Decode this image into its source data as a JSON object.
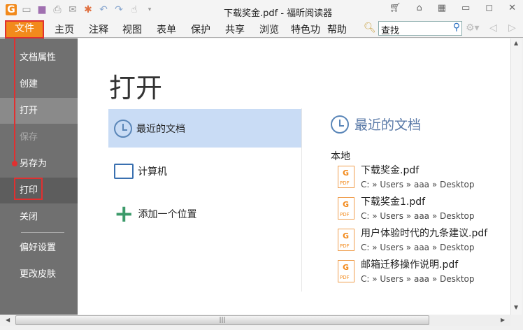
{
  "window": {
    "title": "下载奖金.pdf - 福昕阅读器"
  },
  "menu": {
    "file": "文件",
    "items": [
      "主页",
      "注释",
      "视图",
      "表单",
      "保护",
      "共享",
      "浏览",
      "特色功",
      "帮助"
    ],
    "search_placeholder": "查找"
  },
  "sidebar": {
    "items": [
      "文档属性",
      "创建",
      "打开",
      "保存",
      "另存为",
      "打印",
      "关闭",
      "偏好设置",
      "更改皮肤"
    ]
  },
  "main": {
    "heading": "打开",
    "options": [
      "最近的文档",
      "计算机",
      "添加一个位置"
    ],
    "recent_title": "最近的文档",
    "local_label": "本地",
    "files": [
      {
        "name": "下载奖金.pdf",
        "path": "C: » Users » aaa » Desktop"
      },
      {
        "name": "下载奖金1.pdf",
        "path": "C: » Users » aaa » Desktop"
      },
      {
        "name": "用户体验时代的九条建议.pdf",
        "path": "C: » Users » aaa » Desktop"
      },
      {
        "name": "邮箱迁移操作说明.pdf",
        "path": "C: » Users » aaa » Desktop"
      }
    ]
  },
  "colors": {
    "accent": "#f28a1c",
    "highlight": "#c9dcf5",
    "annotation": "#e03030"
  }
}
